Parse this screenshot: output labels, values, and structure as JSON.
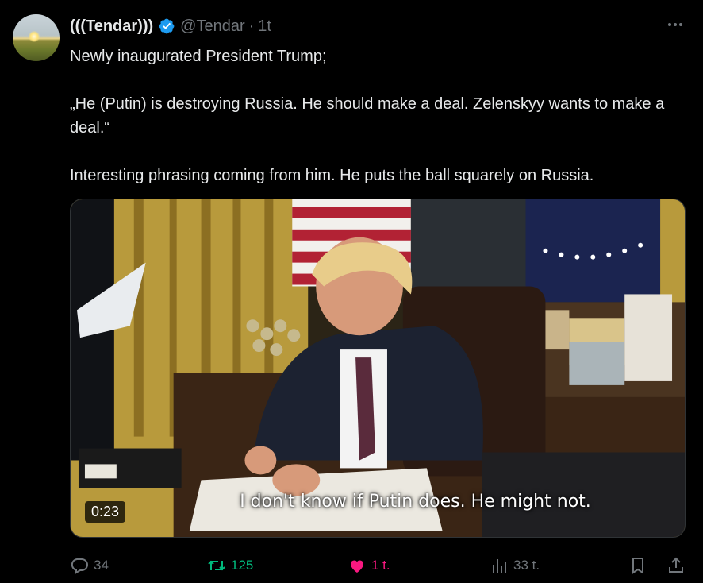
{
  "author": {
    "display_name": "(((Tendar)))",
    "handle": "@Tendar",
    "separator": "·",
    "time": "1t",
    "verified": true
  },
  "tweet": {
    "paragraphs": [
      "Newly inaugurated President Trump;",
      "„He (Putin) is destroying Russia. He should make a deal. Zelenskyy wants to make a deal.“",
      "Interesting phrasing coming from him. He puts the ball squarely on Russia."
    ]
  },
  "media": {
    "subtitle": "I don't know if Putin does. He might not.",
    "duration": "0:23"
  },
  "actions": {
    "replies": "34",
    "reposts": "125",
    "likes": "1 t.",
    "views": "33 t."
  },
  "colors": {
    "background": "#000000",
    "text": "#e7e9ea",
    "muted": "#71767b",
    "verified": "#1d9bf0",
    "repost": "#00ba7c",
    "like": "#f91880"
  },
  "icons": [
    "verified-badge-icon",
    "more-icon",
    "reply-icon",
    "repost-icon",
    "like-icon",
    "views-icon",
    "bookmark-icon",
    "share-icon"
  ]
}
